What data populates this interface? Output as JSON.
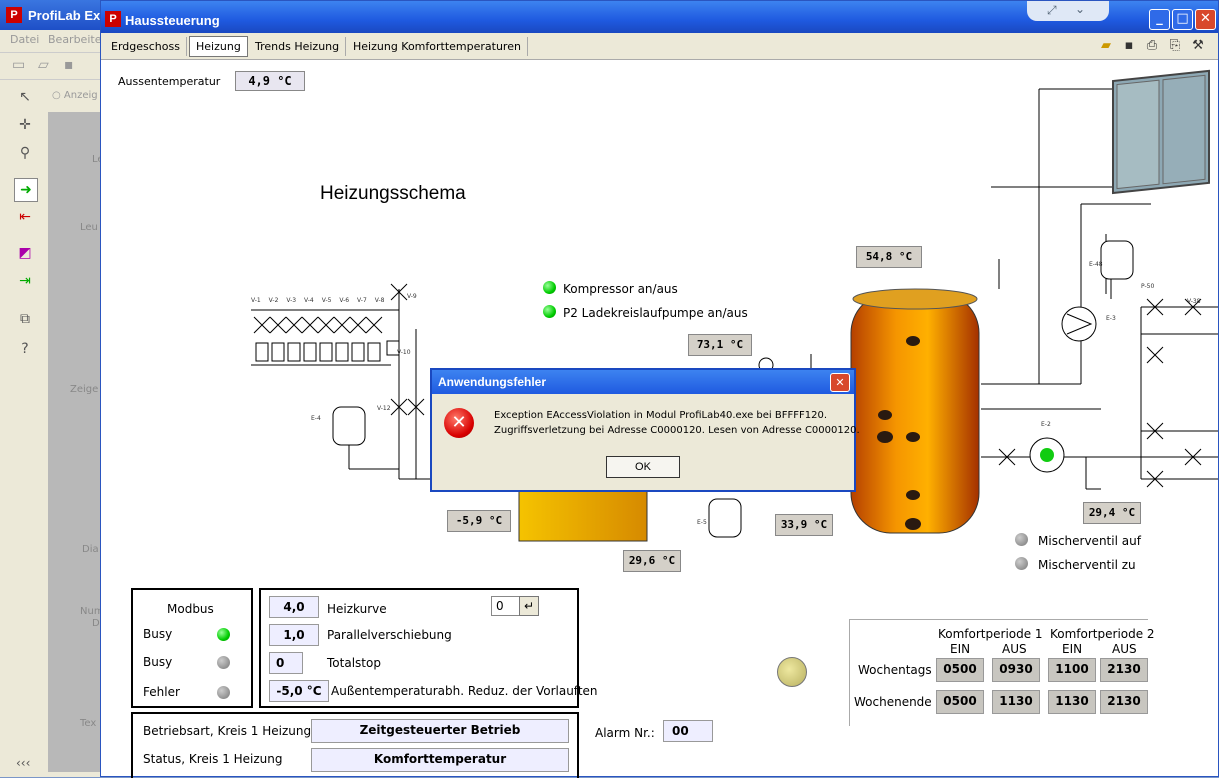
{
  "bg_app": {
    "title": "ProfiLab Ex",
    "menu": [
      "Datei",
      "Bearbeiten"
    ],
    "radio_label": "Anzeig",
    "canvas_labels": [
      "Le",
      "Leu",
      "Zeige",
      "Dia",
      "Num",
      "D",
      "Tex"
    ],
    "bottom_nav": "‹‹‹"
  },
  "window": {
    "title": "Haussteuerung",
    "tabs": [
      "Erdgeschoss",
      "Heizung",
      "Trends Heizung",
      "Heizung Komforttemperaturen"
    ],
    "active_tab": "Heizung"
  },
  "outdoor": {
    "label": "Aussentemperatur",
    "value": "4,9 °C"
  },
  "schema_title": "Heizungsschema",
  "status_leds": [
    {
      "label": "Kompressor an/aus",
      "state": "on"
    },
    {
      "label": "P2 Ladekreislaufpumpe an/aus",
      "state": "on"
    }
  ],
  "temperatures": {
    "t1": "54,8 °C",
    "t2": "73,1 °C",
    "t3": "-5,9 °C",
    "t4": "33,9 °C",
    "t5": "29,6 °C",
    "t6": "29,4 °C"
  },
  "mixer": [
    {
      "label": "Mischerventil auf",
      "state": "off"
    },
    {
      "label": "Mischerventil zu",
      "state": "off"
    }
  ],
  "modbus": {
    "title": "Modbus",
    "rows": [
      {
        "label": "Busy",
        "state": "on"
      },
      {
        "label": "Busy",
        "state": "off"
      },
      {
        "label": "Fehler",
        "state": "off"
      }
    ]
  },
  "params": [
    {
      "value": "4,0",
      "label": "Heizkurve"
    },
    {
      "value": "1,0",
      "label": "Parallelverschiebung"
    },
    {
      "value": "0",
      "label": "Totalstop"
    },
    {
      "value": "-5,0 °C",
      "label": "Außentemperaturabh. Reduz. der Vorlauften"
    }
  ],
  "heizkurve_spin": "0",
  "enter_symbol": "↵",
  "mode": {
    "rows": [
      {
        "label": "Betriebsart, Kreis 1 Heizung",
        "value": "Zeitgesteuerter Betrieb"
      },
      {
        "label": "Status, Kreis 1 Heizung",
        "value": "Komforttemperatur"
      }
    ]
  },
  "alarm": {
    "label": "Alarm Nr.:",
    "value": "00"
  },
  "comfort": {
    "p1": "Komfortperiode 1",
    "p2": "Komfortperiode 2",
    "ein": "EIN",
    "aus": "AUS",
    "rows": [
      {
        "label": "Wochentags",
        "values": [
          "0500",
          "0930",
          "1100",
          "2130"
        ]
      },
      {
        "label": "Wochenende",
        "values": [
          "0500",
          "1130",
          "1130",
          "2130"
        ]
      }
    ]
  },
  "dialog": {
    "title": "Anwendungsfehler",
    "line1": "Exception EAccessViolation in Modul ProfiLab40.exe bei BFFFF120.",
    "line2": "Zugriffsverletzung bei Adresse C0000120. Lesen von Adresse C0000120.",
    "ok": "OK"
  },
  "valve_labels": [
    "V-1",
    "V-2",
    "V-3",
    "V-4",
    "V-5",
    "V-6",
    "V-7",
    "V-8",
    "V-9",
    "V-10",
    "V-12",
    "E-4",
    "E-5",
    "E-2",
    "E-3",
    "E-48",
    "P-50",
    "V-38"
  ]
}
